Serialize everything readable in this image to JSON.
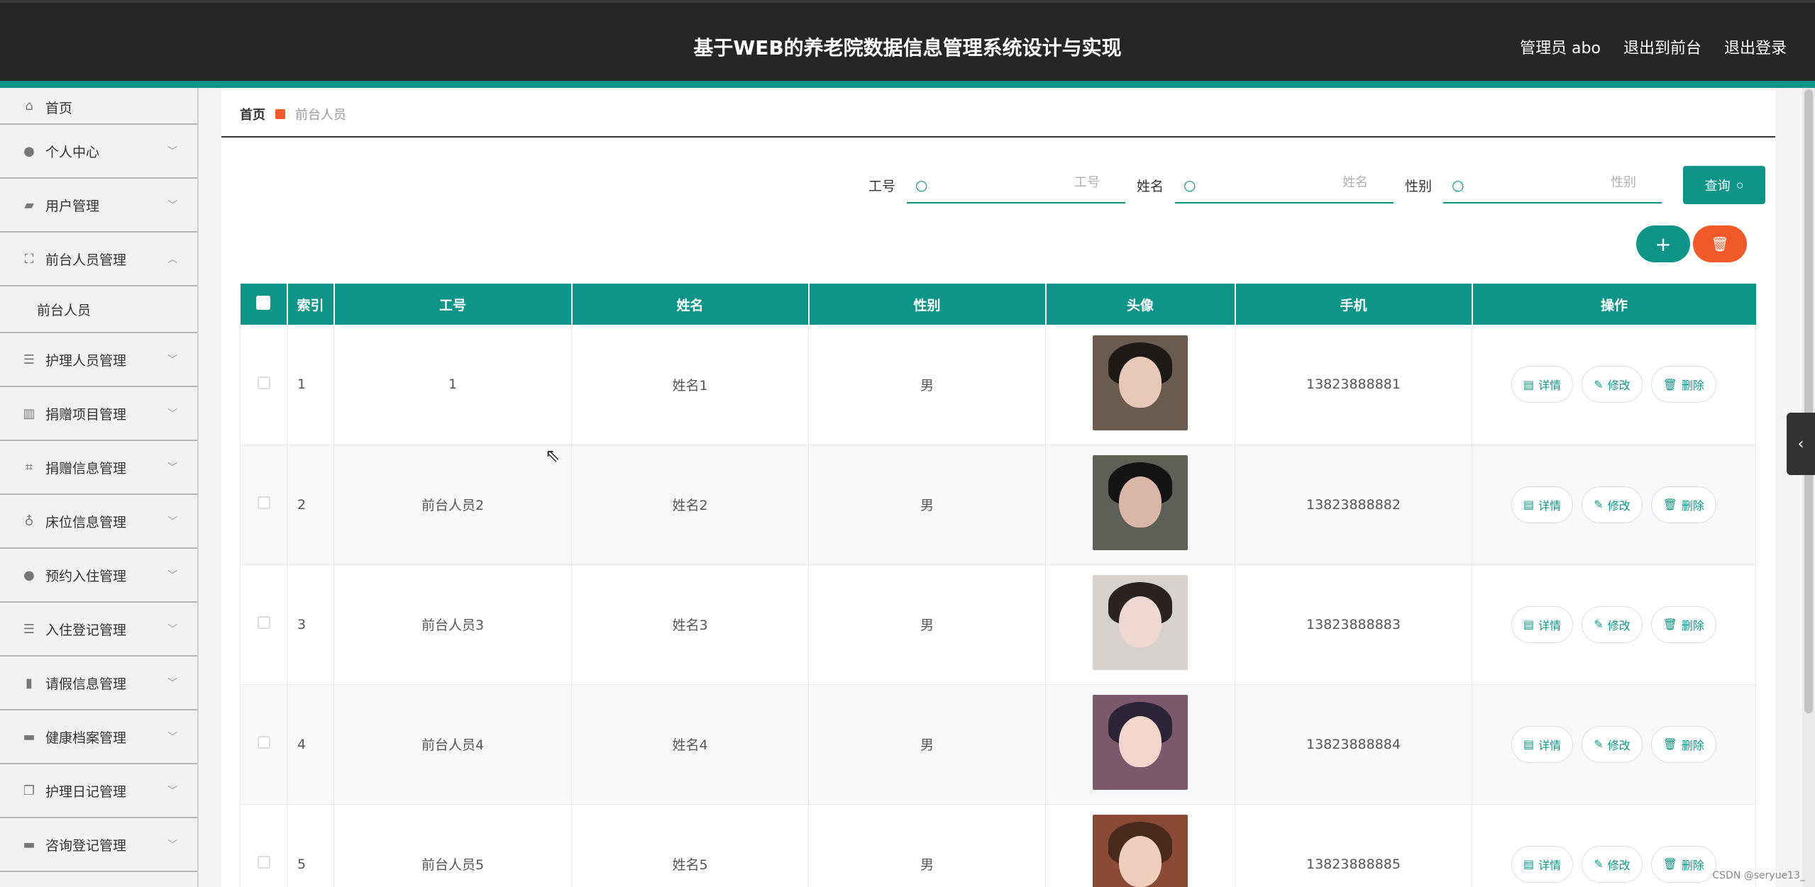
{
  "header": {
    "title": "基于WEB的养老院数据信息管理系统设计与实现",
    "user": "管理员 abo",
    "to_front": "退出到前台",
    "logout": "退出登录"
  },
  "sidebar": {
    "items": [
      {
        "label": "首页",
        "icon": "home-icon"
      },
      {
        "label": "个人中心",
        "icon": "user-icon"
      },
      {
        "label": "用户管理",
        "icon": "users-icon"
      },
      {
        "label": "前台人员管理",
        "icon": "scan-icon",
        "expanded": true
      },
      {
        "label": "护理人员管理",
        "icon": "list-icon"
      },
      {
        "label": "捐赠项目管理",
        "icon": "library-icon"
      },
      {
        "label": "捐赠信息管理",
        "icon": "crop-icon"
      },
      {
        "label": "床位信息管理",
        "icon": "mic-icon"
      },
      {
        "label": "预约入住管理",
        "icon": "user-icon"
      },
      {
        "label": "入住登记管理",
        "icon": "list-icon"
      },
      {
        "label": "请假信息管理",
        "icon": "bar-chart-icon"
      },
      {
        "label": "健康档案管理",
        "icon": "comment-icon"
      },
      {
        "label": "护理日记管理",
        "icon": "copy-icon"
      },
      {
        "label": "咨询登记管理",
        "icon": "ticket-icon"
      }
    ],
    "subitem": "前台人员"
  },
  "breadcrumb": {
    "home": "首页",
    "current": "前台人员"
  },
  "search": {
    "label_id": "工号",
    "placeholder_id": "工号",
    "label_name": "姓名",
    "placeholder_name": "姓名",
    "label_gender": "性别",
    "placeholder_gender": "性别",
    "query_label": "查询"
  },
  "actions": {
    "add_symbol": "+",
    "delete_symbol": "🗑"
  },
  "table": {
    "headers": [
      "索引",
      "工号",
      "姓名",
      "性别",
      "头像",
      "手机",
      "操作"
    ],
    "rows": [
      {
        "index": "1",
        "id": "1",
        "name": "姓名1",
        "gender": "男",
        "phone": "13823888881"
      },
      {
        "index": "2",
        "id": "前台人员2",
        "name": "姓名2",
        "gender": "男",
        "phone": "13823888882"
      },
      {
        "index": "3",
        "id": "前台人员3",
        "name": "姓名3",
        "gender": "男",
        "phone": "13823888883"
      },
      {
        "index": "4",
        "id": "前台人员4",
        "name": "姓名4",
        "gender": "男",
        "phone": "13823888884"
      },
      {
        "index": "5",
        "id": "前台人员5",
        "name": "姓名5",
        "gender": "男",
        "phone": "13823888885"
      }
    ],
    "ops": {
      "detail": "详情",
      "edit": "修改",
      "delete": "删除"
    }
  },
  "colors": {
    "accent": "#0f9488",
    "danger": "#f05a2a",
    "header_bg": "#262626"
  },
  "watermark": "CSDN @seryue13_"
}
